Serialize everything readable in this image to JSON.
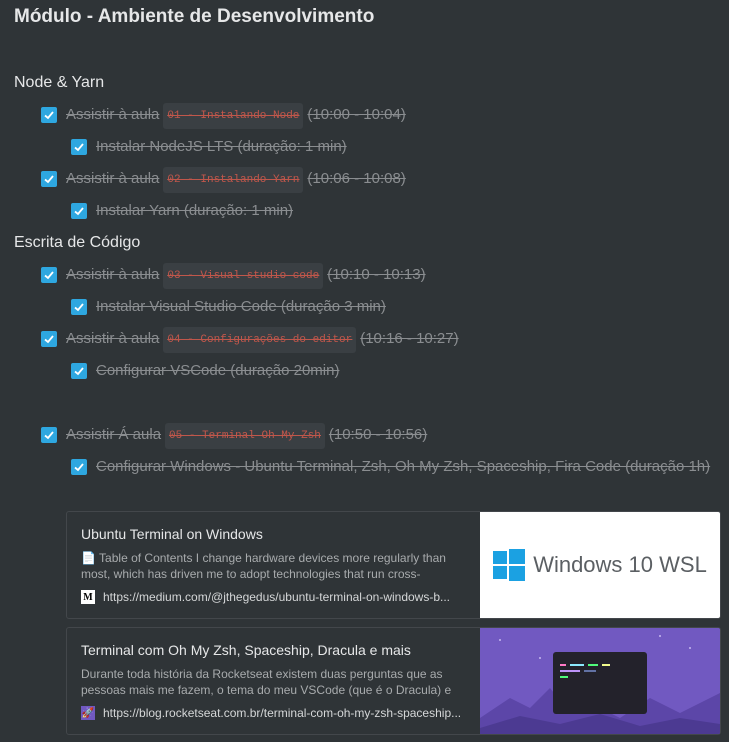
{
  "page": {
    "title": "Módulo - Ambiente de Desenvolvimento"
  },
  "sections": [
    {
      "title": "Node & Yarn"
    },
    {
      "title": "Escrita de Código"
    }
  ],
  "tasks": {
    "t1": {
      "prefix": "Assistir à aula",
      "code": "01 - Instalando Node",
      "time": "(10:00 - 10:04)"
    },
    "t1a": {
      "label": "Instalar NodeJS LTS (duração: 1 min)"
    },
    "t2": {
      "prefix": "Assistir à aula",
      "code": "02 - Instalando Yarn",
      "time": "(10:06 - 10:08)"
    },
    "t2a": {
      "label": "Instalar Yarn (duração: 1 min)"
    },
    "t3": {
      "prefix": "Assistir à aula",
      "code": "03 - Visual studio code",
      "time": "(10:10 - 10:13)"
    },
    "t3a": {
      "label": "Instalar Visual Studio Code (duração 3 min)"
    },
    "t4": {
      "prefix": "Assistir à aula",
      "code": "04 - Configurações do editor",
      "time": "(10:16 - 10:27)"
    },
    "t4a": {
      "label": "Configurar VSCode (duração 20min)"
    },
    "t5": {
      "prefix": "Assistir Á aula",
      "code": "05 - Terminal Oh My Zsh",
      "time": "(10:50 - 10:56)"
    },
    "t5a": {
      "label": "Configurar Windows - Ubuntu Terminal, Zsh, Oh My Zsh, Spaceship, Fira Code (duração 1h)"
    }
  },
  "cards": [
    {
      "title": "Ubuntu Terminal on Windows",
      "description": "📄 Table of Contents I change hardware devices more regularly than most, which has driven me to adopt technologies that run cross-",
      "url": "https://medium.com/@jthegedus/ubuntu-terminal-on-windows-b...",
      "favicon_letter": "M",
      "thumb_text": "Windows 10 WSL"
    },
    {
      "title": "Terminal com Oh My Zsh, Spaceship, Dracula e mais",
      "description": "Durante toda história da Rocketseat existem duas perguntas que as pessoas mais me fazem, o tema do meu VSCode (que é o Dracula) e as",
      "url": "https://blog.rocketseat.com.br/terminal-com-oh-my-zsh-spaceship...",
      "favicon_letter": "🚀"
    }
  ],
  "colors": {
    "background": "#2f3437",
    "checkbox": "#2ea7e0",
    "code": "#c1574b",
    "thumb_purple": "#7159c1"
  }
}
